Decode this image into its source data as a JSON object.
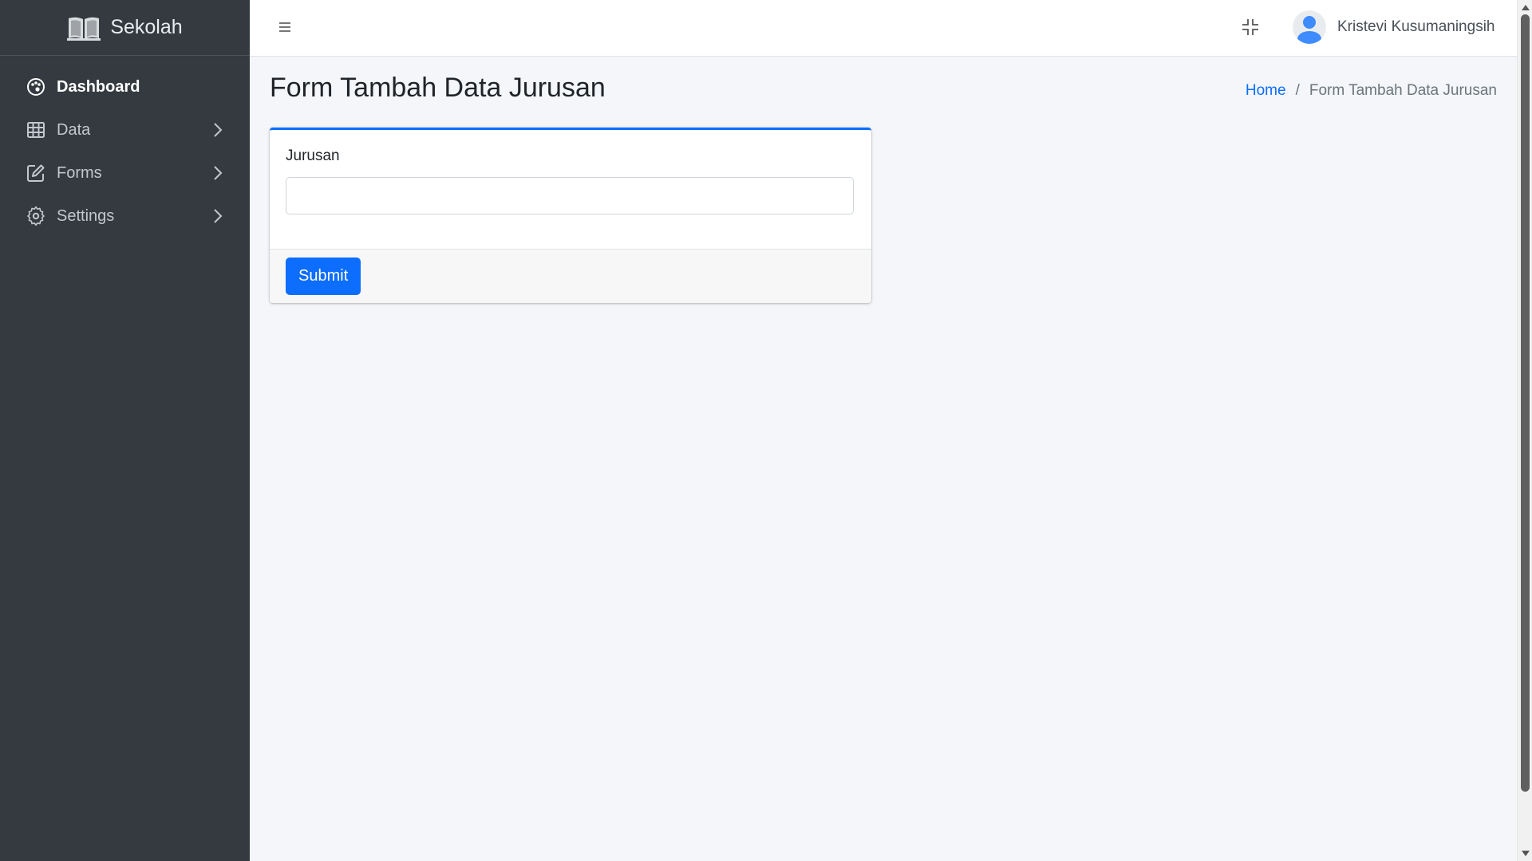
{
  "brand": {
    "name": "Sekolah",
    "icon": "book-open-icon"
  },
  "sidebar": {
    "items": [
      {
        "label": "Dashboard",
        "icon": "palette-icon",
        "active": true,
        "has_children": false
      },
      {
        "label": "Data",
        "icon": "table-icon",
        "active": false,
        "has_children": true
      },
      {
        "label": "Forms",
        "icon": "pencil-square-icon",
        "active": false,
        "has_children": true
      },
      {
        "label": "Settings",
        "icon": "gear-icon",
        "active": false,
        "has_children": true
      }
    ]
  },
  "topbar": {
    "menu_icon": "hamburger-icon",
    "fullscreen_icon": "fullscreen-exit-icon",
    "user": {
      "name": "Kristevi Kusumaningsih",
      "avatar_icon": "user-avatar-icon"
    }
  },
  "header": {
    "title": "Form Tambah Data Jurusan",
    "breadcrumb": {
      "home": "Home",
      "separator": "/",
      "current": "Form Tambah Data Jurusan"
    }
  },
  "form": {
    "label": "Jurusan",
    "value": "",
    "placeholder": "",
    "submit_label": "Submit"
  },
  "colors": {
    "sidebar_bg": "#343a40",
    "primary": "#0d6efd",
    "content_bg": "#f4f6f9"
  }
}
